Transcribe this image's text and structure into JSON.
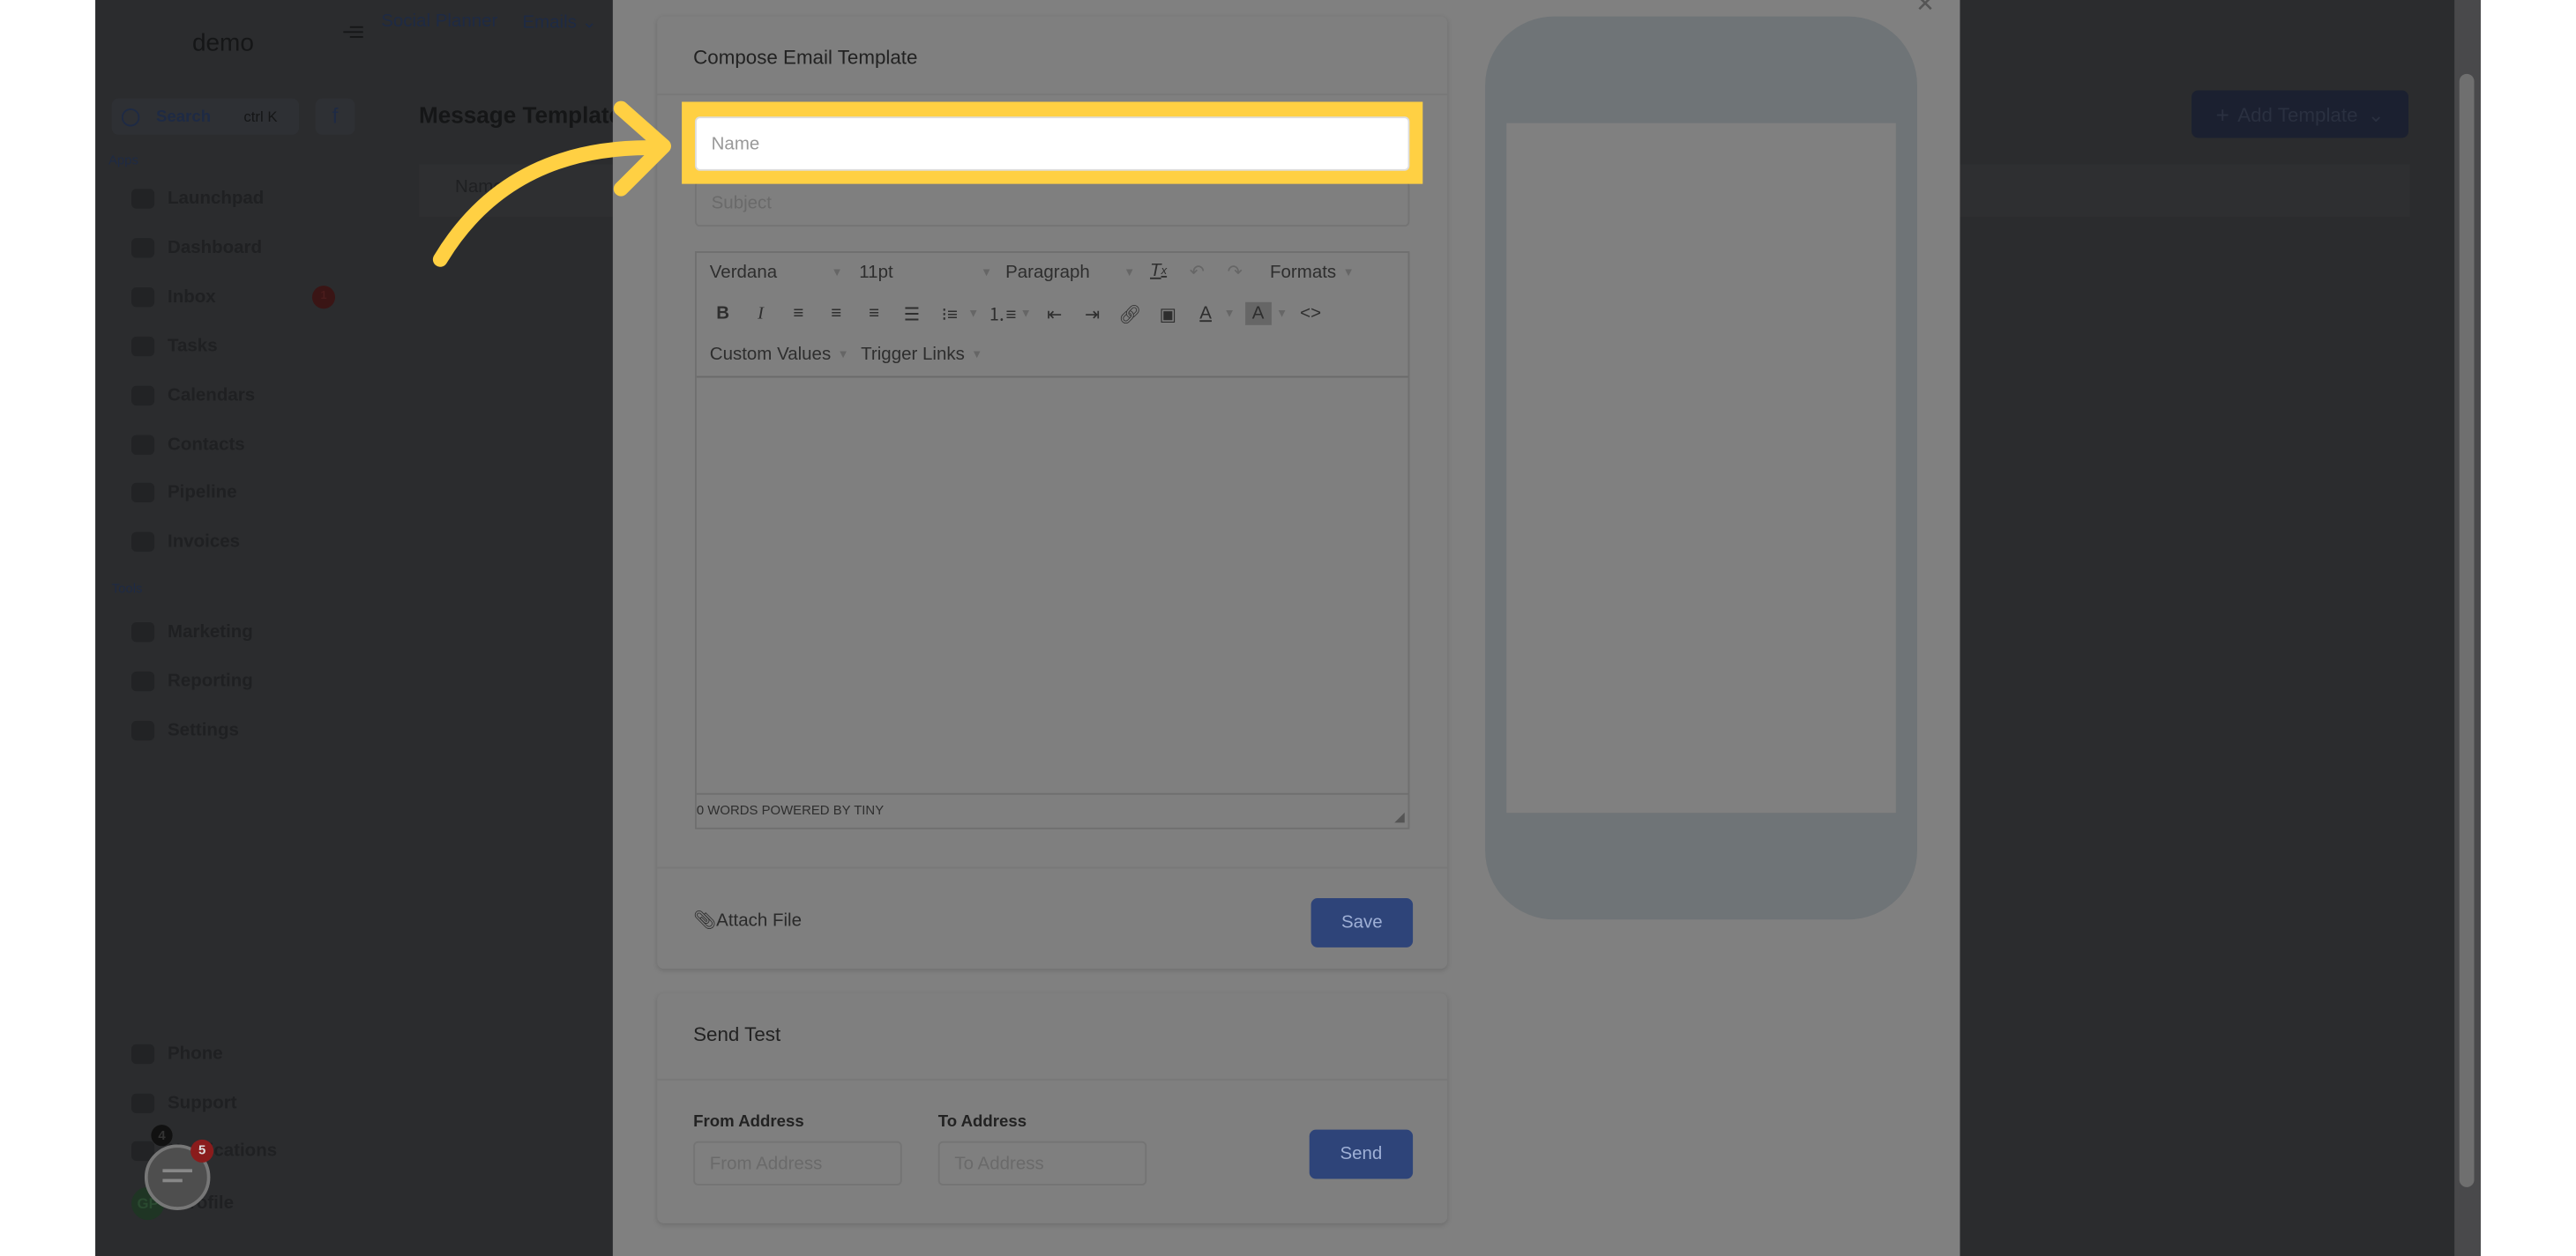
{
  "app": {
    "logo": "demo"
  },
  "topnav": {
    "items": [
      {
        "label": "Social Planner"
      },
      {
        "label": "Emails"
      }
    ]
  },
  "sidebar": {
    "search_label": "Search",
    "search_shortcut": "ctrl K",
    "apps_heading": "Apps",
    "apps": [
      {
        "label": "Launchpad",
        "icon": "rocket-icon"
      },
      {
        "label": "Dashboard",
        "icon": "dashboard-icon"
      },
      {
        "label": "Inbox",
        "icon": "inbox-icon",
        "badge": "1"
      },
      {
        "label": "Tasks",
        "icon": "tasks-icon"
      },
      {
        "label": "Calendars",
        "icon": "calendar-icon"
      },
      {
        "label": "Contacts",
        "icon": "contacts-icon"
      },
      {
        "label": "Pipeline",
        "icon": "funnel-icon"
      },
      {
        "label": "Invoices",
        "icon": "invoice-icon"
      }
    ],
    "tools_heading": "Tools",
    "tools": [
      {
        "label": "Marketing",
        "icon": "megaphone-icon"
      },
      {
        "label": "Reporting",
        "icon": "chart-icon"
      },
      {
        "label": "Settings",
        "icon": "gear-icon"
      }
    ],
    "bottom": [
      {
        "label": "Phone",
        "icon": "phone-icon"
      },
      {
        "label": "Support",
        "icon": "support-icon"
      },
      {
        "label": "Notifications",
        "icon": "bell-icon",
        "badge": "4"
      },
      {
        "label": "Profile",
        "avatar": "GP"
      }
    ]
  },
  "main": {
    "title": "Message Templates",
    "table_header_name": "Name",
    "add_template_label": "Add Template"
  },
  "chat_widget": {
    "badge": "5"
  },
  "modal": {
    "compose_title": "Compose Email Template",
    "name_placeholder": "Name",
    "subject_placeholder": "Subject",
    "editor": {
      "font": "Verdana",
      "size": "11pt",
      "block": "Paragraph",
      "formats": "Formats",
      "custom_values": "Custom Values",
      "trigger_links": "Trigger Links",
      "status": "0 WORDS POWERED BY TINY"
    },
    "attach_label": "Attach File",
    "save_label": "Save",
    "send_test_title": "Send Test",
    "from_label": "From Address",
    "from_placeholder": "From Address",
    "to_label": "To Address",
    "to_placeholder": "To Address",
    "send_label": "Send"
  },
  "colors": {
    "highlight": "#ffd043",
    "primary_dimmed": "#2e4479",
    "overlay": "#808080"
  }
}
